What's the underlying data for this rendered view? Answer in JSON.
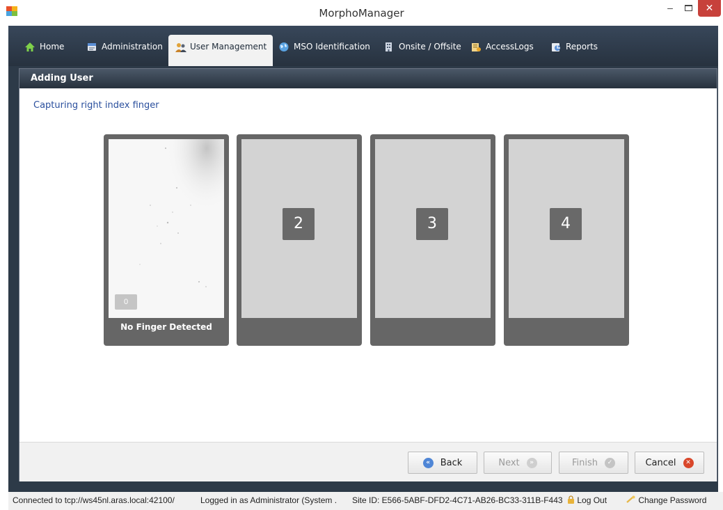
{
  "window": {
    "title": "MorphoManager",
    "minimize_glyph": "–",
    "close_glyph": "✕"
  },
  "tabs": [
    {
      "label": "Home",
      "icon": "home-icon"
    },
    {
      "label": "Administration",
      "icon": "administration-icon"
    },
    {
      "label": "User Management",
      "icon": "user-management-icon",
      "active": true
    },
    {
      "label": "MSO Identification",
      "icon": "globe-icon"
    },
    {
      "label": "Onsite / Offsite",
      "icon": "building-icon"
    },
    {
      "label": "AccessLogs",
      "icon": "access-logs-icon"
    },
    {
      "label": "Reports",
      "icon": "reports-icon"
    }
  ],
  "panel": {
    "title": "Adding User",
    "instruction": "Capturing right index finger"
  },
  "captures": [
    {
      "number": "0",
      "caption": "No Finger Detected",
      "state": "active"
    },
    {
      "number": "2",
      "caption": "",
      "state": "pending"
    },
    {
      "number": "3",
      "caption": "",
      "state": "pending"
    },
    {
      "number": "4",
      "caption": "",
      "state": "pending"
    }
  ],
  "buttons": {
    "back": "Back",
    "next": "Next",
    "finish": "Finish",
    "cancel": "Cancel"
  },
  "status": {
    "connection": "Connected to tcp://ws45nl.aras.local:42100/",
    "login": "Logged in as Administrator (System .",
    "site": "Site ID: E566-5ABF-DFD2-4C71-AB26-BC33-311B-F443",
    "logout": "Log Out",
    "change_password": "Change Password"
  },
  "colors": {
    "tab_bar": "#2d3a48",
    "instruction_text": "#2a4f9d",
    "close_button": "#c7413b",
    "card": "#666666",
    "cancel_icon": "#d9472b"
  }
}
